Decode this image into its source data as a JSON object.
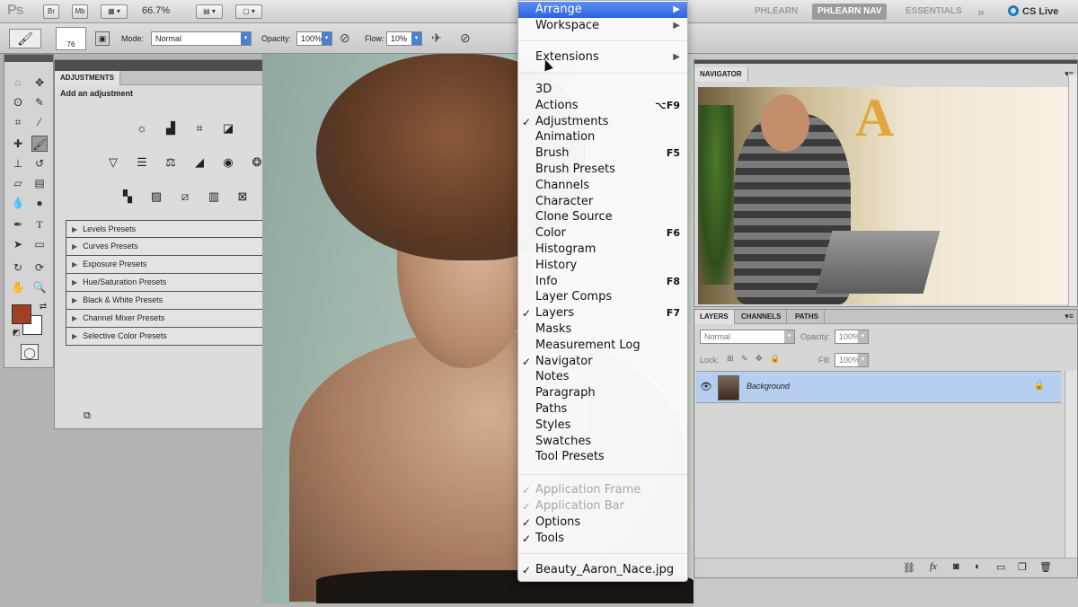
{
  "appbar": {
    "logo": "Ps",
    "btn_bridge": "Br",
    "btn_minibridge": "Mb",
    "zoom": "66.7%",
    "workspaces": [
      "PHLEARN",
      "PHLEARN NAV",
      "ESSENTIALS"
    ],
    "more": "»",
    "cs_live": "CS Live"
  },
  "options": {
    "brush_size": "76",
    "mode_label": "Mode:",
    "mode_value": "Normal",
    "opacity_label": "Opacity:",
    "opacity_value": "100%",
    "flow_label": "Flow:",
    "flow_value": "10%"
  },
  "adjustments": {
    "tab": "ADJUSTMENTS",
    "heading": "Add an adjustment",
    "presets": [
      "Levels Presets",
      "Curves Presets",
      "Exposure Presets",
      "Hue/Saturation Presets",
      "Black & White Presets",
      "Channel Mixer Presets",
      "Selective Color Presets"
    ]
  },
  "navigator": {
    "tab": "NAVIGATOR",
    "letter": "A"
  },
  "layers": {
    "tabs": [
      "LAYERS",
      "CHANNELS",
      "PATHS"
    ],
    "blend": "Normal",
    "opacity_label": "Opacity:",
    "opacity_value": "100%",
    "lock_label": "Lock:",
    "fill_label": "Fill:",
    "fill_value": "100%",
    "layer_name": "Background"
  },
  "menu": {
    "arrange": "Arrange",
    "workspace": "Workspace",
    "extensions": "Extensions",
    "items": [
      {
        "label": "3D",
        "check": "",
        "shortcut": ""
      },
      {
        "label": "Actions",
        "check": "",
        "shortcut": "⌥F9"
      },
      {
        "label": "Adjustments",
        "check": "✓",
        "shortcut": ""
      },
      {
        "label": "Animation",
        "check": "",
        "shortcut": ""
      },
      {
        "label": "Brush",
        "check": "",
        "shortcut": "F5"
      },
      {
        "label": "Brush Presets",
        "check": "",
        "shortcut": ""
      },
      {
        "label": "Channels",
        "check": "",
        "shortcut": ""
      },
      {
        "label": "Character",
        "check": "",
        "shortcut": ""
      },
      {
        "label": "Clone Source",
        "check": "",
        "shortcut": ""
      },
      {
        "label": "Color",
        "check": "",
        "shortcut": "F6"
      },
      {
        "label": "Histogram",
        "check": "",
        "shortcut": ""
      },
      {
        "label": "History",
        "check": "",
        "shortcut": ""
      },
      {
        "label": "Info",
        "check": "",
        "shortcut": "F8"
      },
      {
        "label": "Layer Comps",
        "check": "",
        "shortcut": ""
      },
      {
        "label": "Layers",
        "check": "✓",
        "shortcut": "F7"
      },
      {
        "label": "Masks",
        "check": "",
        "shortcut": ""
      },
      {
        "label": "Measurement Log",
        "check": "",
        "shortcut": ""
      },
      {
        "label": "Navigator",
        "check": "✓",
        "shortcut": ""
      },
      {
        "label": "Notes",
        "check": "",
        "shortcut": ""
      },
      {
        "label": "Paragraph",
        "check": "",
        "shortcut": ""
      },
      {
        "label": "Paths",
        "check": "",
        "shortcut": ""
      },
      {
        "label": "Styles",
        "check": "",
        "shortcut": ""
      },
      {
        "label": "Swatches",
        "check": "",
        "shortcut": ""
      },
      {
        "label": "Tool Presets",
        "check": "",
        "shortcut": ""
      }
    ],
    "app_frame": "Application Frame",
    "app_bar": "Application Bar",
    "options": "Options",
    "tools": "Tools",
    "document": "Beauty_Aaron_Nace.jpg",
    "checkmark": "✓",
    "submenu_arrow": "▶"
  }
}
